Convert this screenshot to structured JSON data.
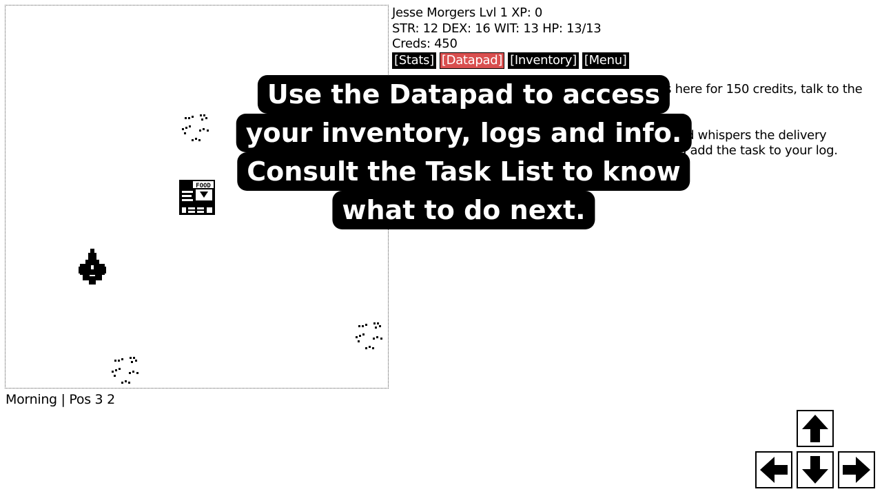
{
  "player": {
    "line1": "Jesse Morgers Lvl 1 XP: 0",
    "line2": "STR: 12 DEX: 16 WIT: 13 HP: 13/13",
    "line3": "Creds: 450"
  },
  "menu": {
    "stats": "[Stats]",
    "datapad": "[Datapad]",
    "inventory": "[Inventory]",
    "menu": "[Menu]"
  },
  "log": {
    "line1": "ks here for 150 credits, talk to the",
    "line2": "nd whispers the delivery",
    "line3": "u add the task to your log."
  },
  "tutorial": {
    "line1": "Use the Datapad to access",
    "line2": "your inventory, logs and info.",
    "line3": "Consult the Task List to know",
    "line4": "what to do next."
  },
  "status": "Morning | Pos 3 2",
  "map": {
    "sign_text": "FOOD"
  }
}
